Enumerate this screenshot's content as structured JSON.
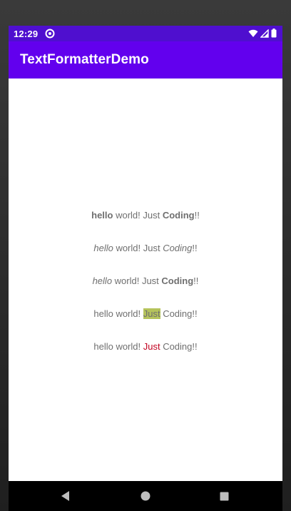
{
  "status_bar": {
    "time": "12:29",
    "icons": [
      "data-saver-icon",
      "wifi-icon",
      "cell-signal-icon",
      "battery-icon"
    ]
  },
  "app_bar": {
    "title": "TextFormatterDemo"
  },
  "lines": [
    {
      "segments": [
        "hello",
        " world! Just ",
        "Coding",
        "!!"
      ]
    },
    {
      "segments": [
        "hello",
        " world! Just ",
        "Coding",
        "!!"
      ]
    },
    {
      "segments": [
        "hello",
        " world! Just ",
        "Coding",
        "!!"
      ]
    },
    {
      "segments": [
        "hello world! ",
        "Just",
        " Coding!!"
      ]
    },
    {
      "segments": [
        "hello world! ",
        "Just",
        " Coding!!"
      ]
    }
  ],
  "colors": {
    "status_bar": "#4f0fcf",
    "app_bar": "#6200ee",
    "highlight_background": "#b5c35b",
    "red_text": "#c2001f",
    "body_text": "#6f6f6f"
  },
  "nav_bar": {
    "icons": [
      "back-icon",
      "home-icon",
      "recents-icon"
    ]
  }
}
